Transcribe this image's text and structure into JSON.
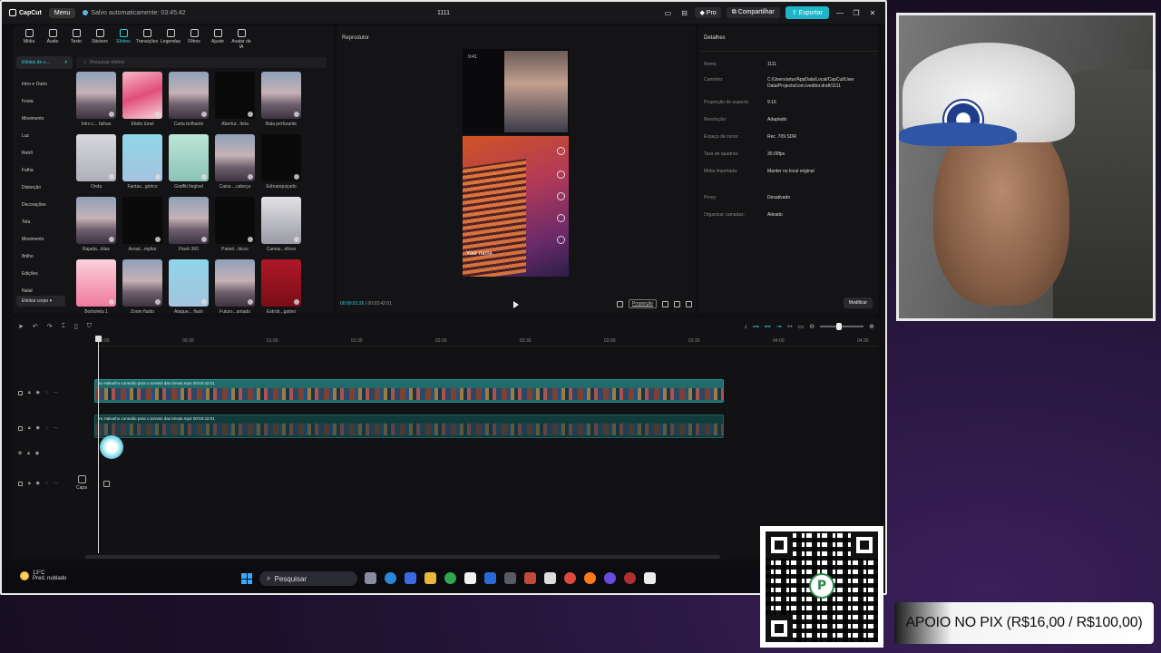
{
  "app": {
    "name": "CapCut",
    "menu_label": "Menu",
    "save_status": "Salvo automaticamente: 03:45:42",
    "project_title": "1111",
    "pro_label": "Pro",
    "share_label": "Compartilhar",
    "export_label": "Exportar"
  },
  "tool_tabs": [
    {
      "label": "Mídia"
    },
    {
      "label": "Áudio"
    },
    {
      "label": "Texto"
    },
    {
      "label": "Stickers"
    },
    {
      "label": "Efeitos"
    },
    {
      "label": "Transições"
    },
    {
      "label": "Legendas"
    },
    {
      "label": "Filtros"
    },
    {
      "label": "Ajuste"
    },
    {
      "label": "Avatar de IA"
    }
  ],
  "effects_panel": {
    "category_header": "Efeitos de v...",
    "search_placeholder": "Pesquisar efeitos",
    "categories": [
      "Intro e Outro",
      "Festa",
      "Movimento",
      "Luz",
      "Retrô",
      "Falha",
      "Distorção",
      "Decorações",
      "Tela",
      "Movimento",
      "Brilho",
      "Edições",
      "Natal"
    ],
    "bottom_category": "Efeitos corpo",
    "effects": [
      {
        "label": "Intro c... falhas",
        "thumb": "city"
      },
      {
        "label": "Efeito túnel",
        "thumb": "pink"
      },
      {
        "label": "Carta brilhante",
        "thumb": "city"
      },
      {
        "label": "Abertur...ítela",
        "thumb": "dark"
      },
      {
        "label": "Bala perfurante",
        "thumb": "city"
      },
      {
        "label": "Onda",
        "thumb": "dance"
      },
      {
        "label": "Fantas...górico",
        "thumb": "dance2"
      },
      {
        "label": "Graffiti Ilegível",
        "thumb": "dance3"
      },
      {
        "label": "Caixa ...cabeça",
        "thumb": "city"
      },
      {
        "label": "Esbranquiçado",
        "thumb": "dark"
      },
      {
        "label": "Rajada...tiilas",
        "thumb": "city"
      },
      {
        "label": "Arrast...mpliar",
        "thumb": "dark"
      },
      {
        "label": "Flash 360",
        "thumb": "city"
      },
      {
        "label": "Painel...iticos",
        "thumb": "dark"
      },
      {
        "label": "Camas...élices",
        "thumb": "white"
      },
      {
        "label": "Borboleta 1",
        "thumb": "girl"
      },
      {
        "label": "Zoom fluido",
        "thumb": "city"
      },
      {
        "label": "Ataque... flash",
        "thumb": "dance2"
      },
      {
        "label": "Futuro...antado",
        "thumb": "city"
      },
      {
        "label": "Estrob...gativo",
        "thumb": "red"
      }
    ]
  },
  "player": {
    "title": "Reprodutor",
    "preview_time": "9:41",
    "preview_username": "Your name",
    "current_time": "00:00:01:26",
    "total_time": "00:03:42:01",
    "ratio_label": "Proporção"
  },
  "details": {
    "title": "Detalhes",
    "rows": [
      {
        "key": "Nome:",
        "value": "1111"
      },
      {
        "key": "Caminho:",
        "value": "C:/Users/artur/AppData/Local/CapCut/User Data/Projects/com.lveditor.draft/1111"
      },
      {
        "key": "Proporção de aspecto:",
        "value": "9:16"
      },
      {
        "key": "Resolução:",
        "value": "Adaptado"
      },
      {
        "key": "Espaço de cores:",
        "value": "Rec. 709 SDR"
      },
      {
        "key": "Taxa de quadros:",
        "value": "30.00fps"
      },
      {
        "key": "Mídia importada:",
        "value": "Manter no local original"
      },
      {
        "key": "Proxy:",
        "value": "Desativado"
      },
      {
        "key": "Organizar camadas:",
        "value": "Ativado"
      }
    ],
    "modify_label": "Modificar"
  },
  "timeline": {
    "ruler_ticks": [
      "00:00",
      "00:30",
      "01:00",
      "01:30",
      "02:00",
      "02:30",
      "03:00",
      "03:30",
      "04:00",
      "04:30"
    ],
    "clip_label": "Yu Hakusho conexão para o torneio das trevas.mp4   00:03:42:01",
    "cover_label": "Capa"
  },
  "taskbar": {
    "temperature": "13°C",
    "weather": "Pred. nublado",
    "search_label": "Pesquisar"
  },
  "overlay": {
    "pix_banner": "APOIO NO PIX (R$16,00 / R$100,00)",
    "qr_center": "P"
  },
  "colors": {
    "accent": "#2cd3e0",
    "clip": "#1f6c6a",
    "export": "#1fb6c9"
  }
}
